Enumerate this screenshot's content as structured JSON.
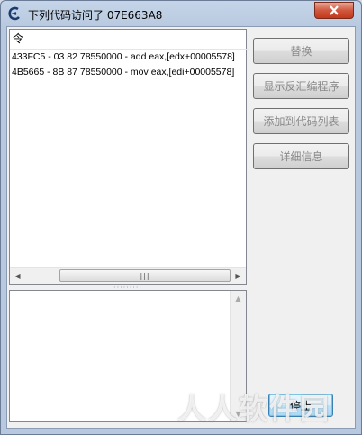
{
  "window": {
    "title": "下列代码访问了 07E663A8",
    "app_icon": "cheat-engine-icon",
    "close_icon": "close-icon"
  },
  "list": {
    "header": "令",
    "rows": [
      "433FC5 - 03 82 78550000  - add eax,[edx+00005578]",
      "4B5665 - 8B 87 78550000  - mov eax,[edi+00005578]"
    ],
    "scroll_thumb_grip": "|||"
  },
  "buttons": {
    "replace": "替换",
    "show_disassembler": "显示反汇编程序",
    "add_to_codelist": "添加到代码列表",
    "more_info": "详细信息",
    "stop": "停止"
  },
  "colors": {
    "titlebar": "#c5d4e8",
    "close_button": "#c2391c",
    "default_button": "#bee6fd"
  },
  "watermark": "人人软件园"
}
